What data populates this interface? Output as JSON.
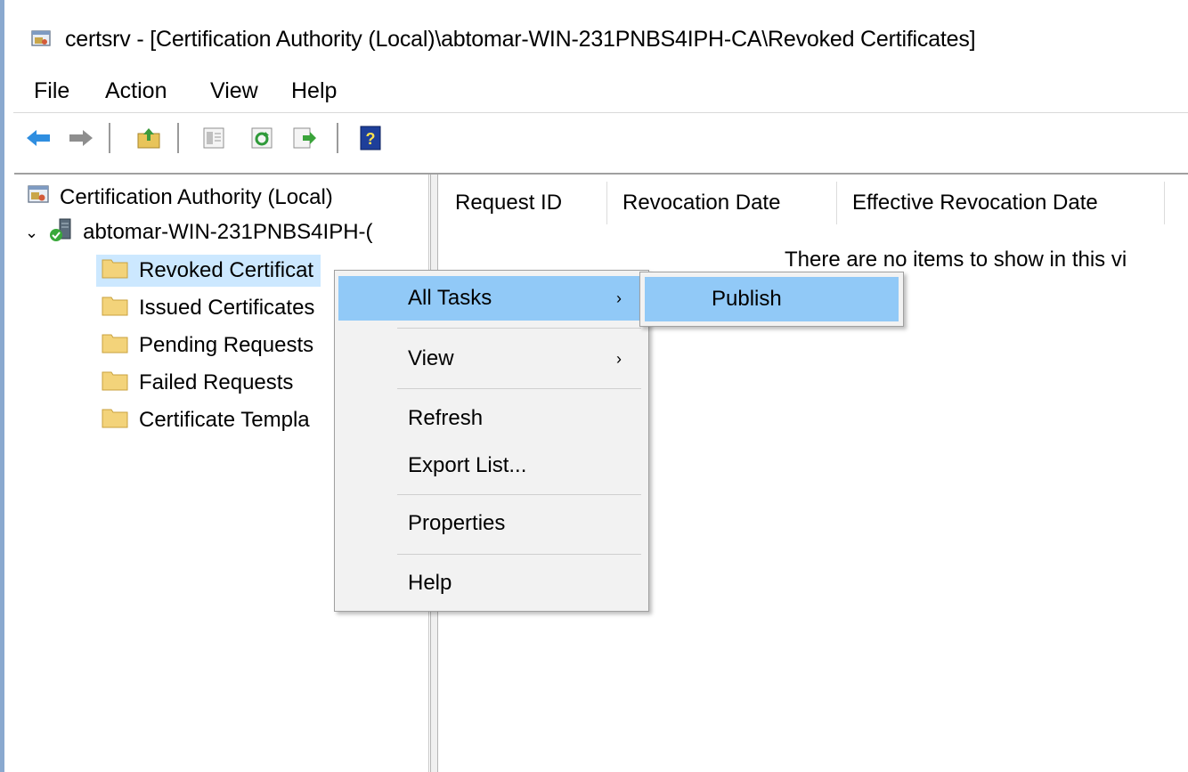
{
  "window": {
    "title": "certsrv - [Certification Authority (Local)\\abtomar-WIN-231PNBS4IPH-CA\\Revoked Certificates]",
    "icon": "mmc-console-icon"
  },
  "menubar": [
    "File",
    "Action",
    "View",
    "Help"
  ],
  "toolbar": {
    "buttons": [
      "back-arrow-icon",
      "forward-arrow-icon",
      "up-folder-icon",
      "show-hide-tree-icon",
      "refresh-icon",
      "export-list-icon",
      "help-icon"
    ],
    "help_label": "?"
  },
  "tree": {
    "root": "Certification Authority (Local)",
    "ca": "abtomar-WIN-231PNBS4IPH-(",
    "items": [
      "Revoked Certificat",
      "Issued Certificates",
      "Pending Requests",
      "Failed Requests",
      "Certificate Templa"
    ]
  },
  "list": {
    "columns": [
      "Request ID",
      "Revocation Date",
      "Effective Revocation Date"
    ],
    "empty_message": "There are no items to show in this vi"
  },
  "context_menu": {
    "items": [
      {
        "label": "All Tasks",
        "arrow": "›"
      },
      {
        "label": "View",
        "arrow": "›"
      },
      {
        "label": "Refresh"
      },
      {
        "label": "Export List..."
      },
      {
        "label": "Properties"
      },
      {
        "label": "Help"
      }
    ],
    "highlighted": "All Tasks"
  },
  "submenu": {
    "items": [
      "Publish"
    ]
  },
  "colors": {
    "highlight": "#91c9f7",
    "selection": "#cce8ff",
    "menu_bg": "#f2f2f2"
  }
}
